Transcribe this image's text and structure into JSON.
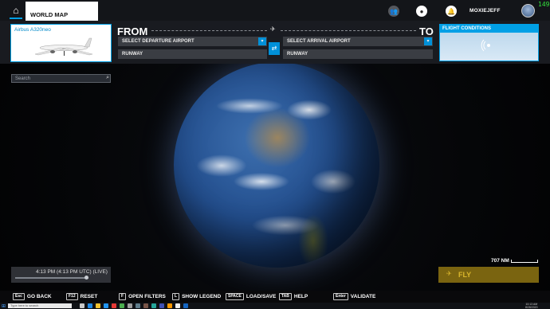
{
  "topbar": {
    "world_map_tab": "WORLD MAP",
    "username": "MOXIEJEFF",
    "fps": "149"
  },
  "aircraft": {
    "name": "Airbus A320neo"
  },
  "route": {
    "from_label": "FROM",
    "to_label": "TO",
    "departure_placeholder": "SELECT DEPARTURE AIRPORT",
    "arrival_placeholder": "SELECT ARRIVAL AIRPORT",
    "departure_runway": "RUNWAY",
    "arrival_runway": "RUNWAY"
  },
  "conditions": {
    "title": "FLIGHT CONDITIONS"
  },
  "search": {
    "placeholder": "Search"
  },
  "time": {
    "text": "4:13 PM (4:13 PM UTC) (LIVE)",
    "progress": 0.97
  },
  "map": {
    "scale_label": "707 NM"
  },
  "fly": {
    "label": "FLY"
  },
  "hints": [
    {
      "key": "Esc",
      "label": "GO BACK"
    },
    {
      "key": "F12",
      "label": "RESET"
    },
    {
      "key": "F",
      "label": "OPEN FILTERS"
    },
    {
      "key": "L",
      "label": "SHOW LEGEND"
    },
    {
      "key": "SPACE",
      "label": "LOAD/SAVE"
    },
    {
      "key": "TAB",
      "label": "HELP"
    },
    {
      "key": "Enter",
      "label": "VALIDATE"
    }
  ],
  "taskbar": {
    "search_placeholder": "Type here to search",
    "clock_time": "10:13 AM",
    "clock_date": "8/28/2020"
  },
  "colors": {
    "accent": "#00a0e6",
    "fly_bg": "#7a6410",
    "fly_text": "#d9b62c",
    "fps": "#34e03c"
  }
}
